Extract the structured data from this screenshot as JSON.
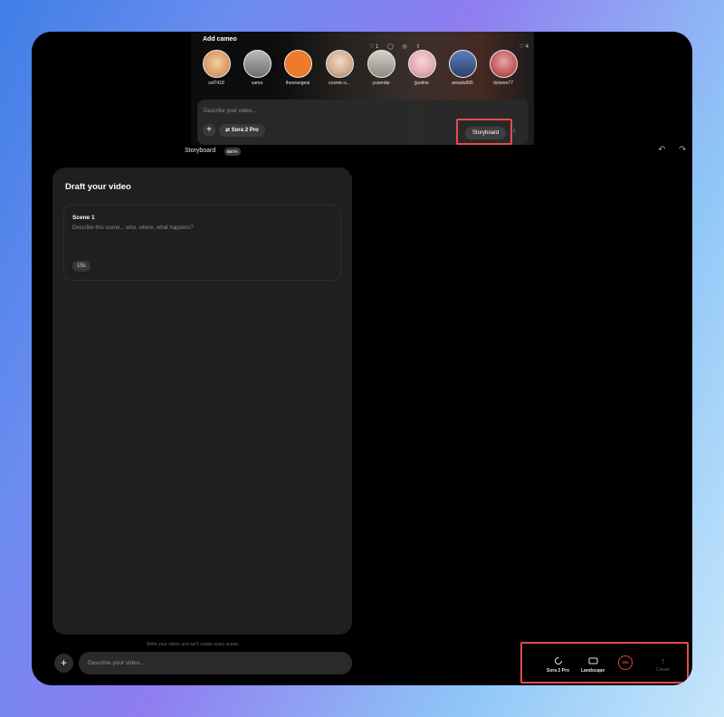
{
  "cameo_strip": {
    "title": "Add cameo",
    "reactions": [
      "♡ 1",
      "◯",
      "◎",
      "⇧"
    ],
    "likes_right": "♡ 4",
    "cameos": [
      {
        "name": "sol7418",
        "color": "#e9b48a"
      },
      {
        "name": "sama",
        "color": "#8f8f8f"
      },
      {
        "name": "theorangeai",
        "color": "#f07a2b"
      },
      {
        "name": "cosmic-s...",
        "color": "#d9c5b3"
      },
      {
        "name": "yuserdai",
        "color": "#bfbab2"
      },
      {
        "name": "jjustine",
        "color": "#e7b8bf"
      },
      {
        "name": "amadu666",
        "color": "#3f5f9a"
      },
      {
        "name": "dolores77",
        "color": "#c35a5a"
      }
    ]
  },
  "prompt_card": {
    "placeholder": "Describe your video...",
    "plus": "+",
    "model": "Sora 2 Pro",
    "storyboard_button": "Storyboard",
    "send": "↑"
  },
  "toolbar": {
    "label": "Storyboard",
    "badge": "BETA",
    "undo": "↶",
    "redo": "↷"
  },
  "draft": {
    "title": "Draft your video",
    "scenes": [
      {
        "title": "Scene 1",
        "description": "Describe this scene... who, where, what happens?",
        "duration": "15s"
      }
    ]
  },
  "bottom": {
    "hint": "Write your vision and we'll create every scene.",
    "plus": "+",
    "input_placeholder": "Describe your video..."
  },
  "controls": {
    "model": "Sora 2 Pro",
    "orientation": "Landscape",
    "duration": "15s",
    "create": "Create",
    "accent_color": "#e0453b",
    "highlight_color": "#e24c4c"
  }
}
